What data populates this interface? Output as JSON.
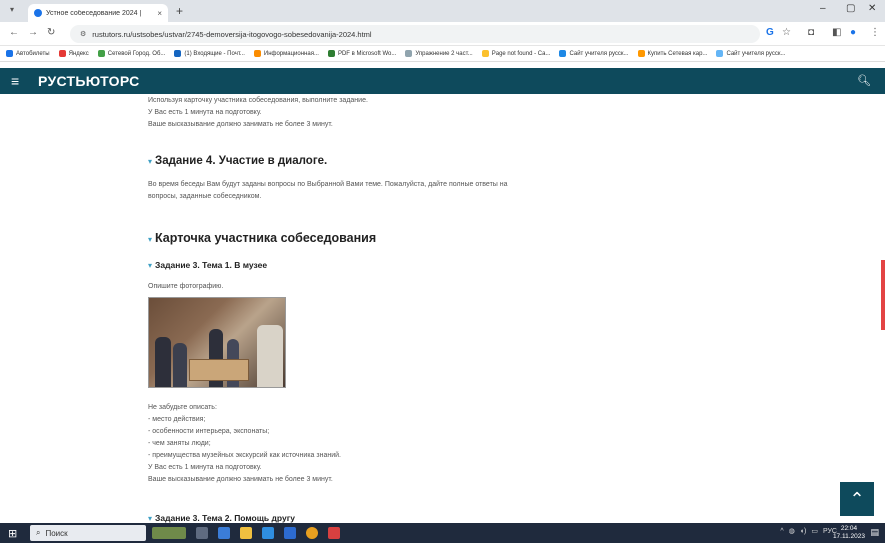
{
  "browser": {
    "tab_title": "Устное собеседование 2024 |",
    "tab_close": "×",
    "new_tab": "+",
    "address": "rustutors.ru/ustsobes/ustvar/2745-demoversija-itogovogo-sobesedovanija-2024.html",
    "bookmarks": [
      {
        "label": "Автобилеты",
        "color": "#1a73e8"
      },
      {
        "label": "Яндекс",
        "color": "#e53935"
      },
      {
        "label": "Сетевой Город. Об...",
        "color": "#43a047"
      },
      {
        "label": "(1) Входящие - Почт...",
        "color": "#1565c0"
      },
      {
        "label": "Информационная...",
        "color": "#fb8c00"
      },
      {
        "label": "PDF в Microsoft Wo...",
        "color": "#2e7d32"
      },
      {
        "label": "Упражнение 2 част...",
        "color": "#90a4ae"
      },
      {
        "label": "Page not found - Ca...",
        "color": "#fbc02d"
      },
      {
        "label": "Сайт учителя русск...",
        "color": "#1e88e5"
      },
      {
        "label": "Купить Сетевая кар...",
        "color": "#ff9800"
      },
      {
        "label": "Сайт учителя русск...",
        "color": "#64b5f6"
      }
    ]
  },
  "site": {
    "logo": "РУСТЬЮТОРС",
    "header_color": "#0e4a5c"
  },
  "content": {
    "intro_lines": [
      "Используя карточку участника собеседования, выполните задание.",
      "У Вас есть 1 минута на подготовку.",
      "Ваше высказывание должно занимать не более 3 минут."
    ],
    "task4_title": "Задание 4. Участие в диалоге.",
    "task4_text_1": "Во время беседы Вам будут заданы вопросы по Выбранной Вами теме. Пожалуйста, дайте полные ответы на",
    "task4_text_2": "вопросы, заданные собеседником.",
    "card_title": "Карточка участника собеседования",
    "task3_theme1": "Задание 3. Тема 1. В музее",
    "describe_photo": "Опишите фотографию.",
    "remember_lines": [
      "Не забудьте описать:",
      "- место действия;",
      "- особенности интерьера, экспонаты;",
      "- чем заняты люди;",
      "- преимущества музейных экскурсий как источника знаний.",
      "У Вас есть 1 минута на подготовку.",
      "Ваше высказывание должно занимать не более 3 минут."
    ],
    "task3_theme2": "Задание 3. Тема 2. Помощь другу"
  },
  "taskbar": {
    "search_placeholder": "Поиск",
    "lang": "РУС",
    "time": "22:04",
    "date": "17.11.2023"
  }
}
